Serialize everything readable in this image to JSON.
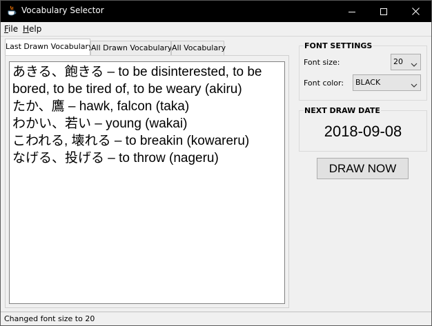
{
  "window": {
    "title": "Vocabulary Selector",
    "icons": {
      "app": "java-coffee-cup-icon",
      "minimize": "minimize-icon",
      "maximize": "maximize-icon",
      "close": "close-icon"
    },
    "colors": {
      "titlebar_bg": "#000000",
      "titlebar_fg": "#ffffff",
      "window_bg": "#f0f0f0"
    }
  },
  "menu": {
    "file": {
      "mnemonic": "F",
      "rest": "ile"
    },
    "help": {
      "mnemonic": "H",
      "rest": "elp"
    }
  },
  "tabs": [
    {
      "label": "Last Drawn Vocabulary",
      "active": true
    },
    {
      "label": "All Drawn Vocabulary",
      "active": false
    },
    {
      "label": "All Vocabulary",
      "active": false
    }
  ],
  "vocabulary": [
    "あきる、飽きる – to be disinterested, to be bored, to be tired of, to be weary (akiru)",
    "たか、鷹 – hawk, falcon (taka)",
    "わかい、若い – young (wakai)",
    "こわれる, 壊れる – to breakin (kowareru)",
    "なげる、投げる – to throw (nageru)"
  ],
  "font_settings": {
    "title": "FONT SETTINGS",
    "size_label": "Font size:",
    "size_value": "20",
    "color_label": "Font color:",
    "color_value": "BLACK"
  },
  "next_draw": {
    "title": "NEXT DRAW DATE",
    "date": "2018-09-08"
  },
  "draw_button": "DRAW NOW",
  "status": "Changed font size to 20"
}
